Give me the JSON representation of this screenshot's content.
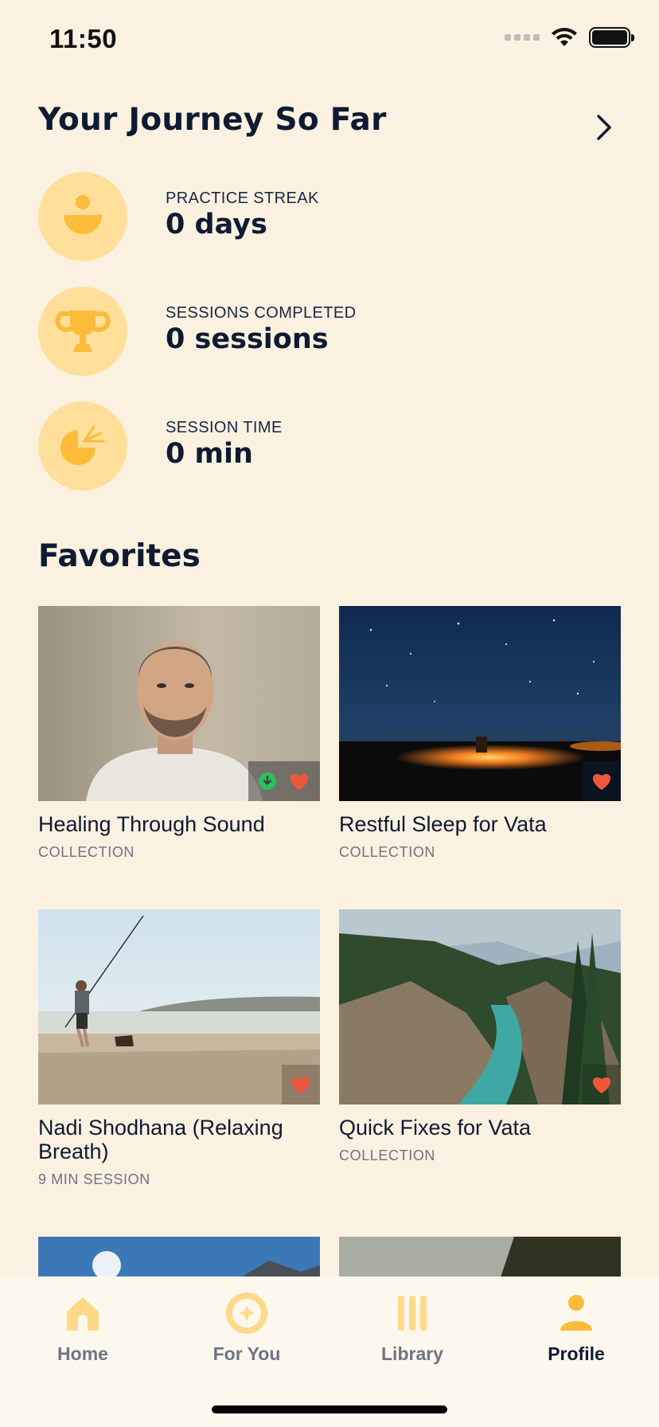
{
  "status_bar": {
    "time": "11:50"
  },
  "journey": {
    "title": "Your Journey So Far",
    "stats": [
      {
        "label": "PRACTICE STREAK",
        "value": "0 days",
        "icon": "meditation-icon"
      },
      {
        "label": "SESSIONS COMPLETED",
        "value": "0 sessions",
        "icon": "trophy-icon"
      },
      {
        "label": "SESSION TIME",
        "value": "0 min",
        "icon": "pie-time-icon"
      }
    ]
  },
  "favorites": {
    "title": "Favorites",
    "items": [
      {
        "title": "Healing Through Sound",
        "subtitle": "COLLECTION",
        "image": "portrait-man",
        "downloaded": true,
        "favorited": true
      },
      {
        "title": "Restful Sleep for Vata",
        "subtitle": "COLLECTION",
        "image": "night-campfire",
        "downloaded": false,
        "favorited": true
      },
      {
        "title": "Nadi Shodhana (Relaxing Breath)",
        "subtitle": "9 MIN SESSION",
        "image": "beach-fishing",
        "downloaded": false,
        "favorited": true
      },
      {
        "title": "Quick Fixes for Vata",
        "subtitle": "COLLECTION",
        "image": "canyon-river",
        "downloaded": false,
        "favorited": true
      }
    ]
  },
  "tab_bar": {
    "tabs": [
      {
        "label": "Home",
        "icon": "home-icon",
        "active": false
      },
      {
        "label": "For You",
        "icon": "for-you-icon",
        "active": false
      },
      {
        "label": "Library",
        "icon": "library-icon",
        "active": false
      },
      {
        "label": "Profile",
        "icon": "profile-icon",
        "active": true
      }
    ]
  },
  "colors": {
    "background": "#faf1e0",
    "accent": "#fdbb3a",
    "accent_light": "#ffdf9a",
    "navy": "#0f1a33",
    "heart": "#f0573a",
    "download": "#2dbf62"
  }
}
